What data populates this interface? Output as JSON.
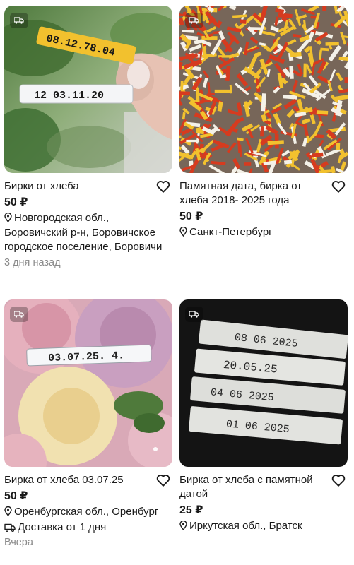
{
  "listings": [
    {
      "title": "Бирки от хлеба",
      "price": "50 ₽",
      "location": "Новгородская обл., Боровичский р-н, Боровичское городское поселение, Боровичи",
      "date": "3 дня назад",
      "photo_tags": [
        "08.12.78.04",
        "12 03.11.20"
      ]
    },
    {
      "title": "Памятная дата, бирка от хлеба 2018- 2025 года",
      "price": "50 ₽",
      "location": "Санкт-Петербург"
    },
    {
      "title": "Бирка от хлеба 03.07.25",
      "price": "50 ₽",
      "location": "Оренбургская обл., Оренбург",
      "delivery": "Доставка от 1 дня",
      "date": "Вчера",
      "photo_tags": [
        "03.07.25. 4."
      ]
    },
    {
      "title": "Бирка от хлеба с памятной датой",
      "price": "25 ₽",
      "location": "Иркутская обл., Братск",
      "photo_tags": [
        "08 06 2025",
        "20.05.25",
        "04 06 2025",
        "01 06 2025"
      ]
    }
  ],
  "colors": {
    "text": "#1a1a1a",
    "muted": "#8a8a8a",
    "tag_yellow": "#f2c12e",
    "tag_red": "#d63b1f"
  }
}
